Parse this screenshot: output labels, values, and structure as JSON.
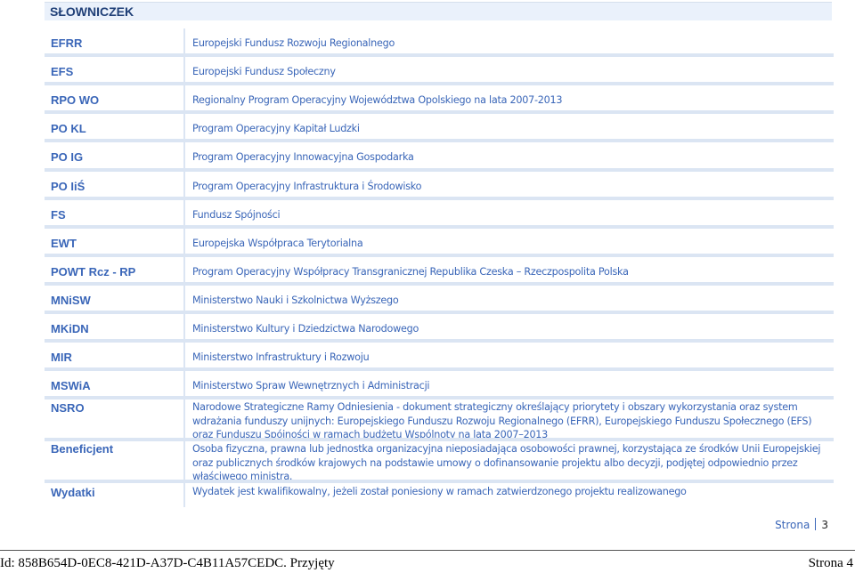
{
  "section_title": "SŁOWNICZEK",
  "entries": [
    {
      "abbr": "EFRR",
      "definition": "Europejski Fundusz Rozwoju Regionalnego"
    },
    {
      "abbr": "EFS",
      "definition": "Europejski Fundusz Społeczny"
    },
    {
      "abbr": "RPO WO",
      "definition": "Regionalny Program Operacyjny Województwa Opolskiego na lata 2007-2013"
    },
    {
      "abbr": "PO KL",
      "definition": "Program Operacyjny Kapitał Ludzki"
    },
    {
      "abbr": "PO IG",
      "definition": "Program Operacyjny Innowacyjna Gospodarka"
    },
    {
      "abbr": "PO IiŚ",
      "definition": "Program Operacyjny Infrastruktura i Środowisko"
    },
    {
      "abbr": "FS",
      "definition": "Fundusz Spójności"
    },
    {
      "abbr": "EWT",
      "definition": "Europejska Współpraca Terytorialna"
    },
    {
      "abbr": "POWT Rcz - RP",
      "definition": "Program Operacyjny Współpracy Transgranicznej Republika Czeska – Rzeczpospolita Polska"
    },
    {
      "abbr": "MNiSW",
      "definition": "Ministerstwo Nauki i Szkolnictwa Wyższego"
    },
    {
      "abbr": "MKiDN",
      "definition": "Ministerstwo Kultury i Dziedzictwa Narodowego"
    },
    {
      "abbr": "MIR",
      "definition": "Ministerstwo Infrastruktury i Rozwoju"
    },
    {
      "abbr": "MSWiA",
      "definition": "Ministerstwo Spraw Wewnętrznych i Administracji"
    },
    {
      "abbr": "NSRO",
      "definition": "Narodowe Strategiczne Ramy Odniesienia - dokument strategiczny określający priorytety i obszary wykorzystania oraz system wdrażania funduszy unijnych: Europejskiego Funduszu Rozwoju Regionalnego (EFRR), Europejskiego Funduszu Społecznego (EFS) oraz Funduszu Spójności w ramach budżetu Wspólnoty na lata 2007–2013"
    },
    {
      "abbr": "Beneficjent",
      "definition": "Osoba fizyczna, prawna lub jednostka organizacyjna nieposiadająca osobowości prawnej, korzystająca ze środków Unii Europejskiej oraz publicznych środków krajowych na podstawie umowy o dofinansowanie projektu albo decyzji, podjętej odpowiednio przez właściwego ministra."
    },
    {
      "abbr": "Wydatki",
      "definition": "Wydatek jest kwalifikowalny, jeżeli został poniesiony w ramach zatwierdzonego projektu realizowanego"
    }
  ],
  "page_label": "Strona",
  "page_number": "3",
  "footer": {
    "left": "Id: 858B654D-0EC8-421D-A37D-C4B11A57CEDC. Przyjęty",
    "right": "Strona 4"
  }
}
